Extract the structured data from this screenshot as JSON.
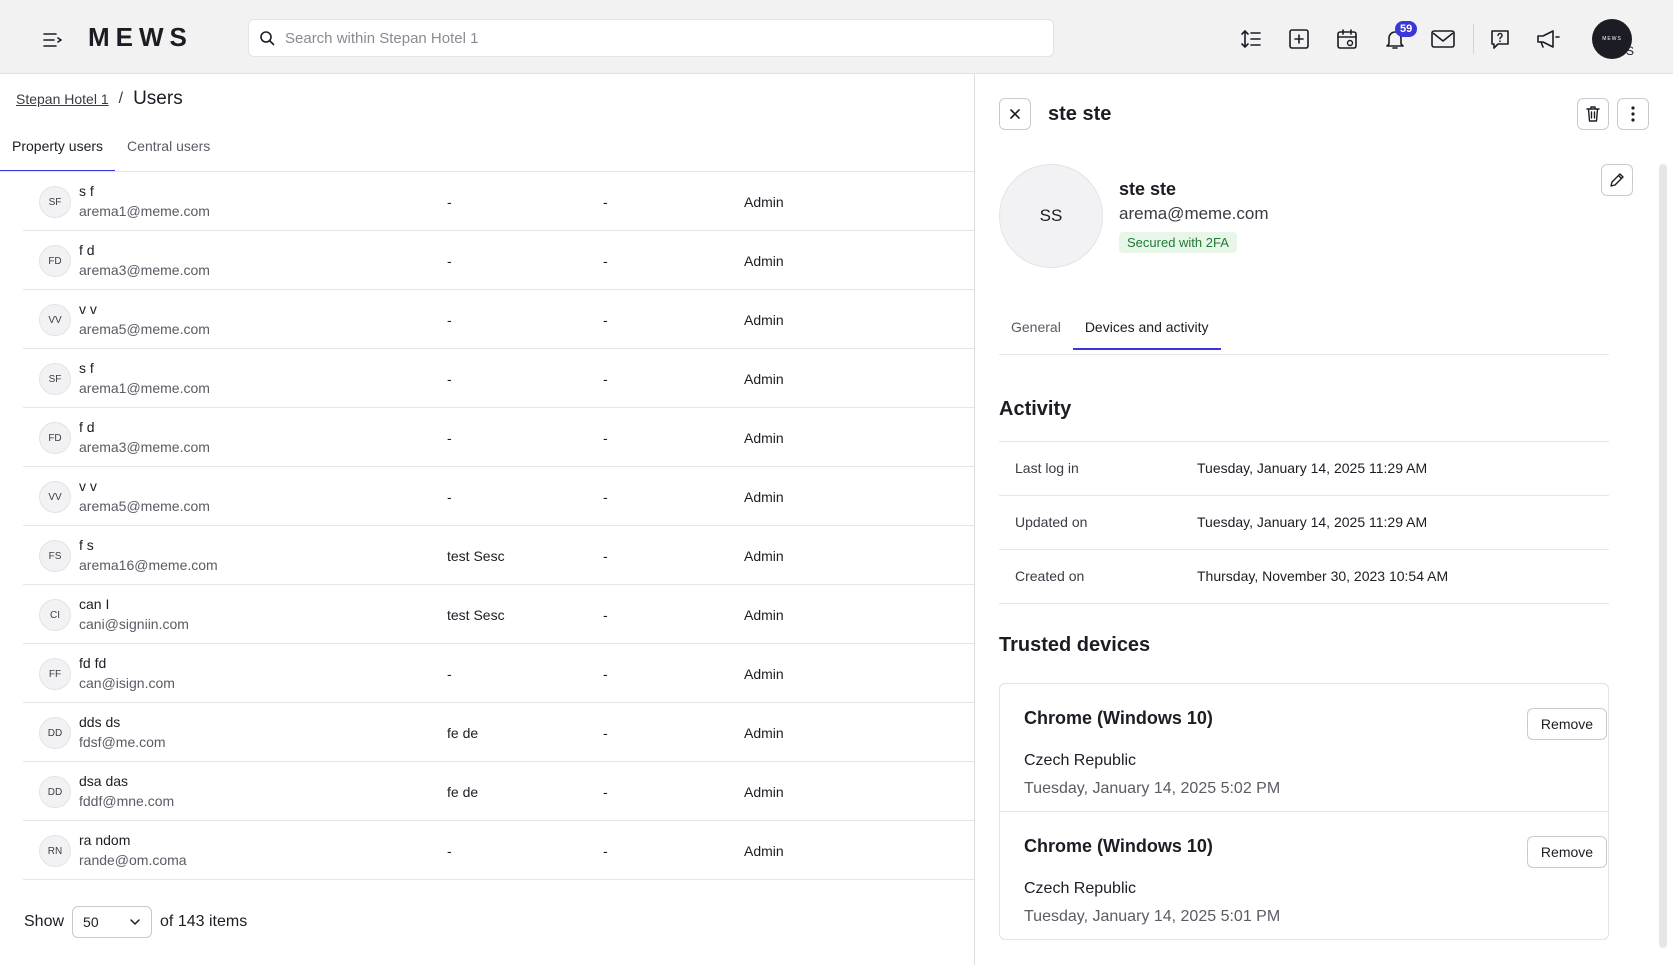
{
  "topbar": {
    "logo": "MEWS",
    "search_placeholder": "Search within Stepan Hotel 1",
    "notification_count": "59",
    "avatar_initial": "S",
    "avatar_logo": "MEWS",
    "icons": [
      "menu-icon",
      "search-icon",
      "sort-lines-icon",
      "add-square-icon",
      "calendar-icon",
      "bell-icon",
      "mail-icon",
      "help-icon",
      "megaphone-icon"
    ]
  },
  "breadcrumb": {
    "parent": "Stepan Hotel 1",
    "separator": "/",
    "current": "Users"
  },
  "tabs": [
    {
      "label": "Property users",
      "active": true
    },
    {
      "label": "Central users",
      "active": false
    }
  ],
  "users": [
    {
      "initials": "SF",
      "name": "s f",
      "email": "arema1@meme.com",
      "col1": "-",
      "col2": "-",
      "role": "Admin"
    },
    {
      "initials": "FD",
      "name": "f d",
      "email": "arema3@meme.com",
      "col1": "-",
      "col2": "-",
      "role": "Admin"
    },
    {
      "initials": "VV",
      "name": "v v",
      "email": "arema5@meme.com",
      "col1": "-",
      "col2": "-",
      "role": "Admin"
    },
    {
      "initials": "SF",
      "name": "s f",
      "email": "arema1@meme.com",
      "col1": "-",
      "col2": "-",
      "role": "Admin"
    },
    {
      "initials": "FD",
      "name": "f d",
      "email": "arema3@meme.com",
      "col1": "-",
      "col2": "-",
      "role": "Admin"
    },
    {
      "initials": "VV",
      "name": "v v",
      "email": "arema5@meme.com",
      "col1": "-",
      "col2": "-",
      "role": "Admin"
    },
    {
      "initials": "FS",
      "name": "f s",
      "email": "arema16@meme.com",
      "col1": "test Sesc",
      "col2": "-",
      "role": "Admin"
    },
    {
      "initials": "CI",
      "name": "can I",
      "email": "cani@signiin.com",
      "col1": "test Sesc",
      "col2": "-",
      "role": "Admin"
    },
    {
      "initials": "FF",
      "name": "fd fd",
      "email": "can@isign.com",
      "col1": "-",
      "col2": "-",
      "role": "Admin"
    },
    {
      "initials": "DD",
      "name": "dds ds",
      "email": "fdsf@me.com",
      "col1": "fe de",
      "col2": "-",
      "role": "Admin"
    },
    {
      "initials": "DD",
      "name": "dsa das",
      "email": "fddf@mne.com",
      "col1": "fe de",
      "col2": "-",
      "role": "Admin"
    },
    {
      "initials": "RN",
      "name": "ra ndom",
      "email": "rande@om.coma",
      "col1": "-",
      "col2": "-",
      "role": "Admin"
    }
  ],
  "pagination": {
    "show_label": "Show",
    "page_size": "50",
    "total_label": "of 143 items"
  },
  "panel": {
    "title": "ste ste",
    "avatar_initials": "SS",
    "name": "ste ste",
    "email": "arema@meme.com",
    "security_badge": "Secured with 2FA",
    "tabs": [
      {
        "label": "General",
        "active": false
      },
      {
        "label": "Devices and activity",
        "active": true
      }
    ],
    "activity_title": "Activity",
    "activity": [
      {
        "label": "Last log in",
        "value": "Tuesday, January 14, 2025 11:29 AM"
      },
      {
        "label": "Updated on",
        "value": "Tuesday, January 14, 2025 11:29 AM"
      },
      {
        "label": "Created on",
        "value": "Thursday, November 30, 2023 10:54 AM"
      }
    ],
    "devices_title": "Trusted devices",
    "devices": [
      {
        "name": "Chrome (Windows 10)",
        "country": "Czech Republic",
        "time": "Tuesday, January 14, 2025 5:02 PM",
        "remove_label": "Remove"
      },
      {
        "name": "Chrome (Windows 10)",
        "country": "Czech Republic",
        "time": "Tuesday, January 14, 2025 5:01 PM",
        "remove_label": "Remove"
      }
    ]
  },
  "colors": {
    "accent": "#3b36d6",
    "badge_green_bg": "#e8f6ea",
    "badge_green_text": "#1f7a34"
  }
}
